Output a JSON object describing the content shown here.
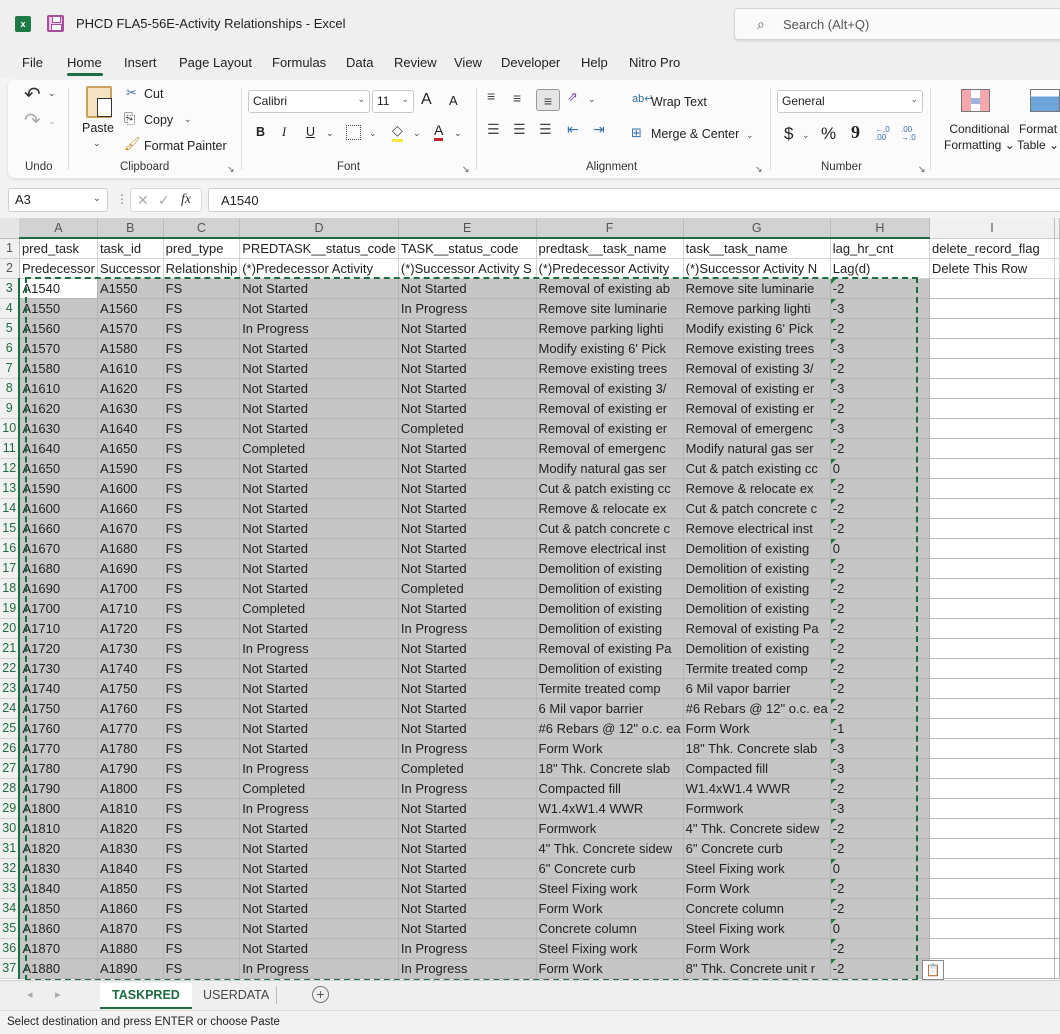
{
  "window": {
    "title": "PHCD FLA5-56E-Activity Relationships  -  Excel",
    "app_icon": "excel-icon",
    "search_placeholder": "Search (Alt+Q)"
  },
  "menu": {
    "tabs": [
      "File",
      "Home",
      "Insert",
      "Page Layout",
      "Formulas",
      "Data",
      "Review",
      "View",
      "Developer",
      "Help",
      "Nitro Pro"
    ],
    "active": "Home"
  },
  "ribbon": {
    "undo_group": {
      "label": "Undo"
    },
    "clipboard": {
      "label": "Clipboard",
      "paste": "Paste",
      "cut": "Cut",
      "copy": "Copy",
      "format_painter": "Format Painter"
    },
    "font": {
      "label": "Font",
      "font_name": "Calibri",
      "font_size": "11",
      "bold": "B",
      "italic": "I",
      "underline": "U",
      "grow": "A",
      "shrink": "A",
      "font_color": "A"
    },
    "alignment": {
      "label": "Alignment",
      "wrap_text": "Wrap Text",
      "merge_center": "Merge & Center"
    },
    "number": {
      "label": "Number",
      "format": "General",
      "currency": "$",
      "percent": "%",
      "comma": "9",
      "inc_decimal": "←.0 .00",
      "dec_decimal": ".00 →.0"
    },
    "styles": {
      "conditional_formatting": [
        "Conditional",
        "Formatting"
      ],
      "format_table": [
        "Format",
        "Table"
      ]
    }
  },
  "formula_bar": {
    "name_box": "A3",
    "fx": "fx",
    "value": "A1540"
  },
  "sheet": {
    "columns": [
      "A",
      "B",
      "C",
      "D",
      "E",
      "F",
      "G",
      "H",
      "I"
    ],
    "header_row": [
      "pred_task",
      "task_id",
      "pred_type",
      "PREDTASK__status_code",
      "TASK__status_code",
      "predtask__task_name",
      "task__task_name",
      "lag_hr_cnt",
      "delete_record_flag"
    ],
    "label_row": [
      "Predecessor",
      "Successor",
      "Relationship",
      "(*)Predecessor Activity",
      "(*)Successor Activity S",
      "(*)Predecessor Activity",
      "(*)Successor Activity N",
      "Lag(d)",
      "Delete This Row"
    ],
    "rows": [
      [
        "A1540",
        "A1550",
        "FS",
        "Not Started",
        "Not Started",
        "Removal of existing ab",
        "Remove site luminarie",
        "-2"
      ],
      [
        "A1550",
        "A1560",
        "FS",
        "Not Started",
        "In Progress",
        "Remove site luminarie",
        "Remove parking lighti",
        "-3"
      ],
      [
        "A1560",
        "A1570",
        "FS",
        "In Progress",
        "Not Started",
        "Remove parking lighti",
        "Modify existing 6' Pick",
        "-2"
      ],
      [
        "A1570",
        "A1580",
        "FS",
        "Not Started",
        "Not Started",
        "Modify existing 6' Pick",
        "Remove existing trees",
        "-3"
      ],
      [
        "A1580",
        "A1610",
        "FS",
        "Not Started",
        "Not Started",
        "Remove existing trees",
        "Removal of existing 3/",
        "-2"
      ],
      [
        "A1610",
        "A1620",
        "FS",
        "Not Started",
        "Not Started",
        "Removal of existing 3/",
        "Removal of existing er",
        "-3"
      ],
      [
        "A1620",
        "A1630",
        "FS",
        "Not Started",
        "Not Started",
        "Removal of existing er",
        "Removal of existing er",
        "-2"
      ],
      [
        "A1630",
        "A1640",
        "FS",
        "Not Started",
        "Completed",
        "Removal of existing er",
        "Removal of emergenc",
        "-3"
      ],
      [
        "A1640",
        "A1650",
        "FS",
        "Completed",
        "Not Started",
        "Removal of emergenc",
        "Modify natural gas ser",
        "-2"
      ],
      [
        "A1650",
        "A1590",
        "FS",
        "Not Started",
        "Not Started",
        "Modify natural gas ser",
        "Cut & patch existing cc",
        "0"
      ],
      [
        "A1590",
        "A1600",
        "FS",
        "Not Started",
        "Not Started",
        "Cut & patch existing cc",
        "Remove & relocate ex",
        "-2"
      ],
      [
        "A1600",
        "A1660",
        "FS",
        "Not Started",
        "Not Started",
        "Remove & relocate ex",
        "Cut & patch concrete c",
        "-2"
      ],
      [
        "A1660",
        "A1670",
        "FS",
        "Not Started",
        "Not Started",
        "Cut & patch concrete c",
        "Remove electrical inst",
        "-2"
      ],
      [
        "A1670",
        "A1680",
        "FS",
        "Not Started",
        "Not Started",
        "Remove electrical inst",
        "Demolition of existing",
        "0"
      ],
      [
        "A1680",
        "A1690",
        "FS",
        "Not Started",
        "Not Started",
        "Demolition of existing",
        "Demolition of existing",
        "-2"
      ],
      [
        "A1690",
        "A1700",
        "FS",
        "Not Started",
        "Completed",
        "Demolition of existing",
        "Demolition of existing",
        "-2"
      ],
      [
        "A1700",
        "A1710",
        "FS",
        "Completed",
        "Not Started",
        "Demolition of existing",
        "Demolition of existing",
        "-2"
      ],
      [
        "A1710",
        "A1720",
        "FS",
        "Not Started",
        "In Progress",
        "Demolition of existing",
        "Removal of existing Pa",
        "-2"
      ],
      [
        "A1720",
        "A1730",
        "FS",
        "In Progress",
        "Not Started",
        "Removal of existing Pa",
        "Demolition of existing",
        "-2"
      ],
      [
        "A1730",
        "A1740",
        "FS",
        "Not Started",
        "Not Started",
        "Demolition of existing",
        "Termite treated comp",
        "-2"
      ],
      [
        "A1740",
        "A1750",
        "FS",
        "Not Started",
        "Not Started",
        "Termite treated comp",
        "6 Mil vapor barrier",
        "-2"
      ],
      [
        "A1750",
        "A1760",
        "FS",
        "Not Started",
        "Not Started",
        "6 Mil vapor barrier",
        "#6 Rebars @ 12\" o.c. ea",
        "-2"
      ],
      [
        "A1760",
        "A1770",
        "FS",
        "Not Started",
        "Not Started",
        "#6 Rebars @ 12\" o.c. ea",
        "Form Work",
        "-1"
      ],
      [
        "A1770",
        "A1780",
        "FS",
        "Not Started",
        "In Progress",
        "Form Work",
        "18\" Thk. Concrete slab",
        "-3"
      ],
      [
        "A1780",
        "A1790",
        "FS",
        "In Progress",
        "Completed",
        "18\" Thk. Concrete slab",
        "Compacted fill",
        "-3"
      ],
      [
        "A1790",
        "A1800",
        "FS",
        "Completed",
        "In Progress",
        "Compacted fill",
        "W1.4xW1.4 WWR",
        "-2"
      ],
      [
        "A1800",
        "A1810",
        "FS",
        "In Progress",
        "Not Started",
        "W1.4xW1.4 WWR",
        "Formwork",
        "-3"
      ],
      [
        "A1810",
        "A1820",
        "FS",
        "Not Started",
        "Not Started",
        "Formwork",
        "4\" Thk. Concrete sidew",
        "-2"
      ],
      [
        "A1820",
        "A1830",
        "FS",
        "Not Started",
        "Not Started",
        "4\" Thk. Concrete sidew",
        "6\" Concrete curb",
        "-2"
      ],
      [
        "A1830",
        "A1840",
        "FS",
        "Not Started",
        "Not Started",
        "6\" Concrete curb",
        "Steel Fixing work",
        "0"
      ],
      [
        "A1840",
        "A1850",
        "FS",
        "Not Started",
        "Not Started",
        "Steel Fixing work",
        "Form Work",
        "-2"
      ],
      [
        "A1850",
        "A1860",
        "FS",
        "Not Started",
        "Not Started",
        "Form Work",
        "Concrete column",
        "-2"
      ],
      [
        "A1860",
        "A1870",
        "FS",
        "Not Started",
        "Not Started",
        "Concrete column",
        "Steel Fixing work",
        "0"
      ],
      [
        "A1870",
        "A1880",
        "FS",
        "Not Started",
        "In Progress",
        "Steel Fixing work",
        "Form Work",
        "-2"
      ],
      [
        "A1880",
        "A1890",
        "FS",
        "In Progress",
        "In Progress",
        "Form Work",
        "8\" Thk. Concrete unit r",
        "-2"
      ]
    ]
  },
  "sheet_tabs": {
    "tabs": [
      "TASKPRED",
      "USERDATA"
    ],
    "active": "TASKPRED",
    "add_label": "+"
  },
  "status_bar": {
    "message": "Select destination and press ENTER or choose Paste"
  },
  "colors": {
    "accent": "#1e6c41",
    "selection": "#c6c6c6"
  }
}
